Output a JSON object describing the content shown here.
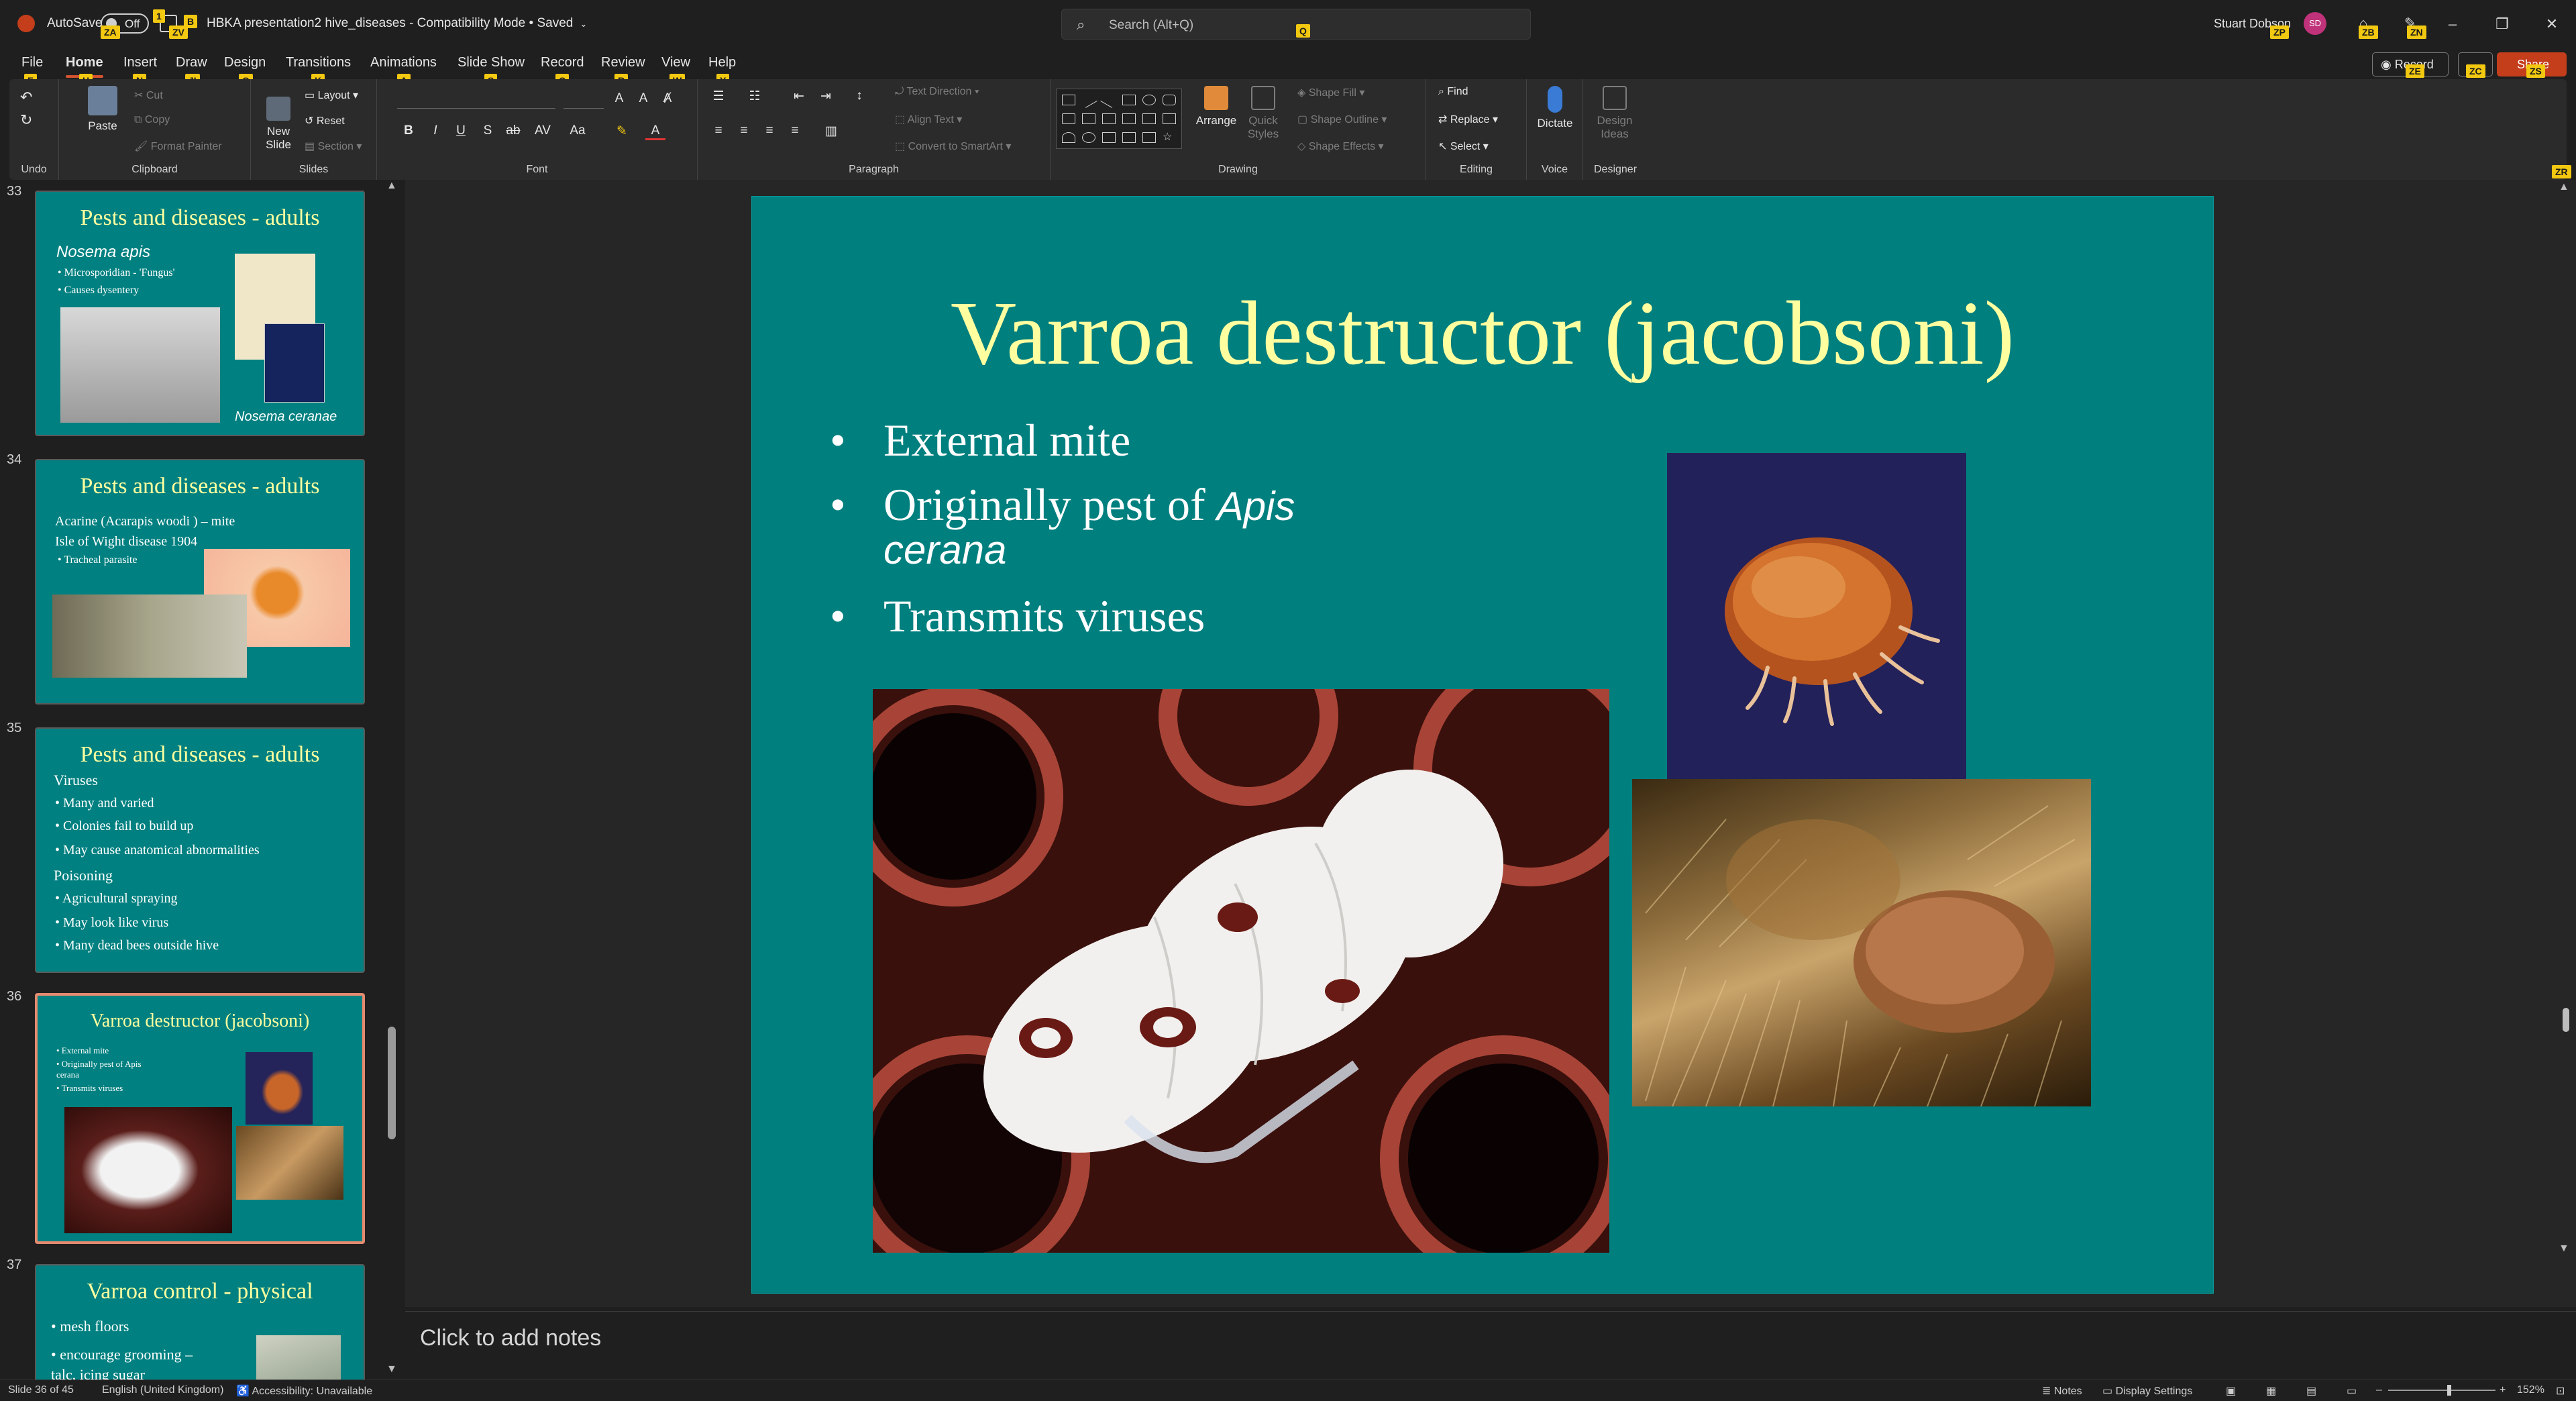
{
  "titlebar": {
    "autosave_label": "AutoSave",
    "autosave_state": "Off",
    "document_title": "HBKA presentation2 hive_diseases - Compatibility Mode • Saved",
    "search_placeholder": "Search (Alt+Q)",
    "user_name": "Stuart Dobson",
    "user_initials": "SD"
  },
  "keytips": {
    "autosave": "ZA",
    "save": "1",
    "doc": "ZV",
    "doc2": "B",
    "search": "Q",
    "user": "ZP",
    "coauth": "ZB",
    "pen": "ZN",
    "record": "ZE",
    "comments": "ZC",
    "share": "ZS",
    "file": "F",
    "home": "H",
    "insert": "N",
    "draw": "JI",
    "design": "G",
    "transitions": "K",
    "animations": "A",
    "slideshow": "S",
    "record_tab": "C",
    "review": "R",
    "view": "W",
    "help": "Y",
    "collapse": "ZR"
  },
  "tabs": [
    "File",
    "Home",
    "Insert",
    "Draw",
    "Design",
    "Transitions",
    "Animations",
    "Slide Show",
    "Record",
    "Review",
    "View",
    "Help"
  ],
  "actions": {
    "record": "Record",
    "share": "Share"
  },
  "ribbon": {
    "undo_label": "Undo",
    "clipboard": {
      "label": "Clipboard",
      "paste": "Paste",
      "cut": "Cut",
      "copy": "Copy",
      "format_painter": "Format Painter"
    },
    "slides": {
      "label": "Slides",
      "new_slide": "New Slide",
      "layout": "Layout",
      "reset": "Reset",
      "section": "Section"
    },
    "font": {
      "label": "Font"
    },
    "paragraph": {
      "label": "Paragraph",
      "text_direction": "Text Direction",
      "align_text": "Align Text",
      "convert_smartart": "Convert to SmartArt"
    },
    "drawing": {
      "label": "Drawing",
      "arrange": "Arrange",
      "quick_styles": "Quick Styles",
      "shape_fill": "Shape Fill",
      "shape_outline": "Shape Outline",
      "shape_effects": "Shape Effects"
    },
    "editing": {
      "label": "Editing",
      "find": "Find",
      "replace": "Replace",
      "select": "Select"
    },
    "voice": {
      "label": "Voice",
      "dictate": "Dictate"
    },
    "designer": {
      "label": "Designer",
      "design_ideas": "Design Ideas"
    }
  },
  "thumbnails": [
    {
      "num": "33",
      "title": "Pests and diseases - adults",
      "lines": [
        "Nosema apis",
        "•  Microsporidian - 'Fungus'",
        "•  Causes dysentery",
        "Nosema ceranae"
      ]
    },
    {
      "num": "34",
      "title": "Pests and diseases - adults",
      "lines": [
        "Acarine (Acarapis woodi ) – mite",
        "Isle of Wight disease 1904",
        "•  Tracheal parasite"
      ]
    },
    {
      "num": "35",
      "title": "Pests and diseases - adults",
      "lines": [
        "Viruses",
        "• Many and varied",
        "• Colonies fail to build up",
        "• May cause anatomical abnormalities",
        "Poisoning",
        "• Agricultural spraying",
        "• May look like virus",
        "• Many dead bees outside hive"
      ]
    },
    {
      "num": "36",
      "title": "Varroa destructor (jacobsoni)",
      "lines": [
        "•  External mite",
        "•  Originally pest of Apis",
        "    cerana",
        "•  Transmits viruses"
      ]
    },
    {
      "num": "37",
      "title": "Varroa control - physical",
      "lines": [
        "• mesh floors",
        "• encourage grooming –",
        "talc, icing sugar"
      ]
    }
  ],
  "slide": {
    "title": "Varroa destructor (jacobsoni)",
    "bullets": [
      {
        "text": "External mite",
        "italic": ""
      },
      {
        "text": "Originally pest of ",
        "italic": "Apis"
      },
      {
        "text": "",
        "italic": "cerana"
      },
      {
        "text": "Transmits viruses",
        "italic": ""
      }
    ],
    "bullet_char": "•",
    "background_color": "#007f7f",
    "title_color": "#ffffa0"
  },
  "notes_placeholder": "Click to add notes",
  "statusbar": {
    "slide_info": "Slide 36 of 45",
    "language": "English (United Kingdom)",
    "accessibility": "Accessibility: Unavailable",
    "notes": "Notes",
    "display_settings": "Display Settings",
    "zoom": "152%"
  },
  "colors": {
    "accent": "#c43e1c",
    "slide_bg": "#007f7f",
    "keytip": "#f2c811"
  }
}
